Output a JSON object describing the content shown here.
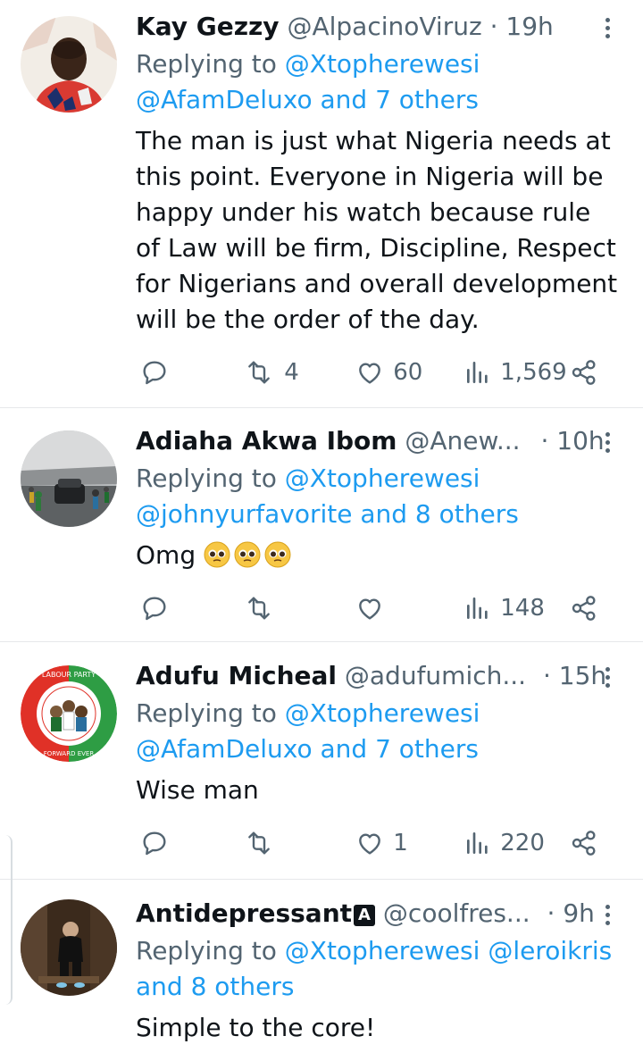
{
  "tweets": [
    {
      "name": "Kay Gezzy",
      "handle": "@AlpacinoViruz",
      "dot": "·",
      "time": "19h",
      "replying_prefix": "Replying to",
      "replying_line1": "@Xtopherewesi",
      "replying_line2": "@AfamDeluxo and 7 others",
      "text": "The man is just what Nigeria needs at this point. Everyone in Nigeria will be happy under his watch because rule of Law will be firm, Discipline, Respect for Nigerians and overall development will be the order of the day.",
      "retweets": "4",
      "likes": "60",
      "views": "1,569"
    },
    {
      "name": "Adiaha Akwa Ibom",
      "handle": "@Anew...",
      "dot": "·",
      "time": "10h",
      "replying_prefix": "Replying to",
      "replying_line1": "@Xtopherewesi",
      "replying_line2": "@johnyurfavorite and 8 others",
      "text": "Omg",
      "emoji_count": 3,
      "retweets": "",
      "likes": "",
      "views": "148"
    },
    {
      "name": "Adufu Micheal",
      "handle": "@adufumich...",
      "dot": "·",
      "time": "15h",
      "replying_prefix": "Replying to",
      "replying_line1": "@Xtopherewesi",
      "replying_line2": "@AfamDeluxo and 7 others",
      "text": "Wise man",
      "retweets": "",
      "likes": "1",
      "views": "220",
      "avatar_text_top": "LABOUR PARTY",
      "avatar_text_bottom": "FORWARD EVER"
    },
    {
      "name": "Antidepressant",
      "badge": "A",
      "handle": "@coolfres...",
      "dot": "·",
      "time": "9h",
      "replying_prefix": "Replying to",
      "replying_line1": "@Xtopherewesi @leroikris",
      "replying_line2": "and 8 others",
      "text": "Simple to the core!"
    }
  ],
  "icons": {
    "reply": "reply-icon",
    "retweet": "retweet-icon",
    "like": "heart-icon",
    "views": "views-icon",
    "share": "share-icon",
    "more": "more-icon"
  },
  "colors": {
    "link": "#1d9bf0",
    "secondary": "#536471",
    "primary": "#0f1419"
  }
}
